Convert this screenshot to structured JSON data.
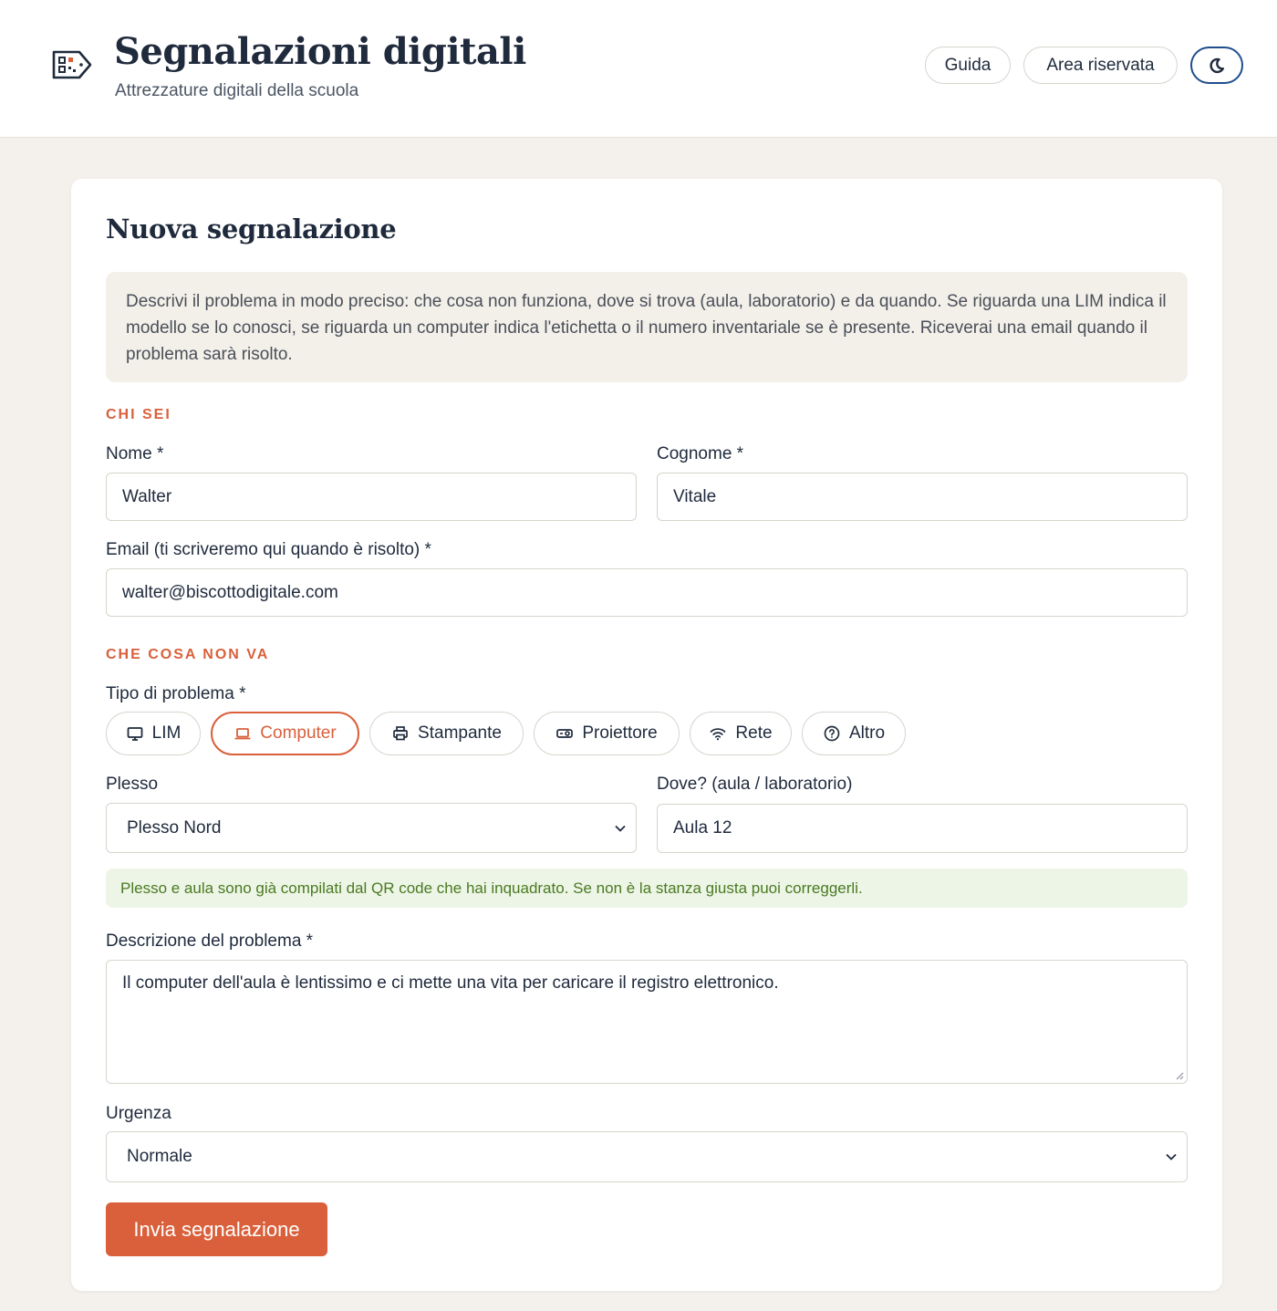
{
  "header": {
    "title": "Segnalazioni digitali",
    "subtitle": "Attrezzature digitali della scuola",
    "nav": {
      "guide": "Guida",
      "reserved": "Area riservata"
    },
    "theme_icon": "moon-icon"
  },
  "form": {
    "title": "Nuova segnalazione",
    "intro": "Descrivi il problema in modo preciso: che cosa non funziona, dove si trova (aula, laboratorio) e da quando. Se riguarda una LIM indica il modello se lo conosci, se riguarda un computer indica l'etichetta o il numero inventariale se è presente. Riceverai una email quando il problema sarà risolto.",
    "section_who": "CHI SEI",
    "first_name": {
      "label": "Nome *",
      "value": "Walter"
    },
    "last_name": {
      "label": "Cognome *",
      "value": "Vitale"
    },
    "email": {
      "label": "Email (ti scriveremo qui quando è risolto) *",
      "value": "walter@biscottodigitale.com"
    },
    "section_what": "CHE COSA NON VA",
    "problem_type": {
      "label": "Tipo di problema *",
      "options": [
        {
          "label": "LIM",
          "icon": "monitor-icon"
        },
        {
          "label": "Computer",
          "icon": "laptop-icon",
          "selected": true
        },
        {
          "label": "Stampante",
          "icon": "printer-icon"
        },
        {
          "label": "Proiettore",
          "icon": "projector-icon"
        },
        {
          "label": "Rete",
          "icon": "wifi-icon"
        },
        {
          "label": "Altro",
          "icon": "help-circle-icon"
        }
      ]
    },
    "building": {
      "label": "Plesso",
      "value": "Plesso Nord"
    },
    "room": {
      "label": "Dove? (aula / laboratorio)",
      "value": "Aula 12"
    },
    "qr_note": "Plesso e aula sono già compilati dal QR code che hai inquadrato. Se non è la stanza giusta puoi correggerli.",
    "description": {
      "label": "Descrizione del problema *",
      "value": "Il computer dell'aula è lentissimo e ci mette una vita per caricare il registro elettronico."
    },
    "urgency": {
      "label": "Urgenza",
      "value": "Normale"
    },
    "submit": "Invia segnalazione"
  },
  "colors": {
    "accent": "#d9603b",
    "navy": "#1f2a3c",
    "success": "#4a7a22",
    "theme_border": "#1f4e8c"
  }
}
